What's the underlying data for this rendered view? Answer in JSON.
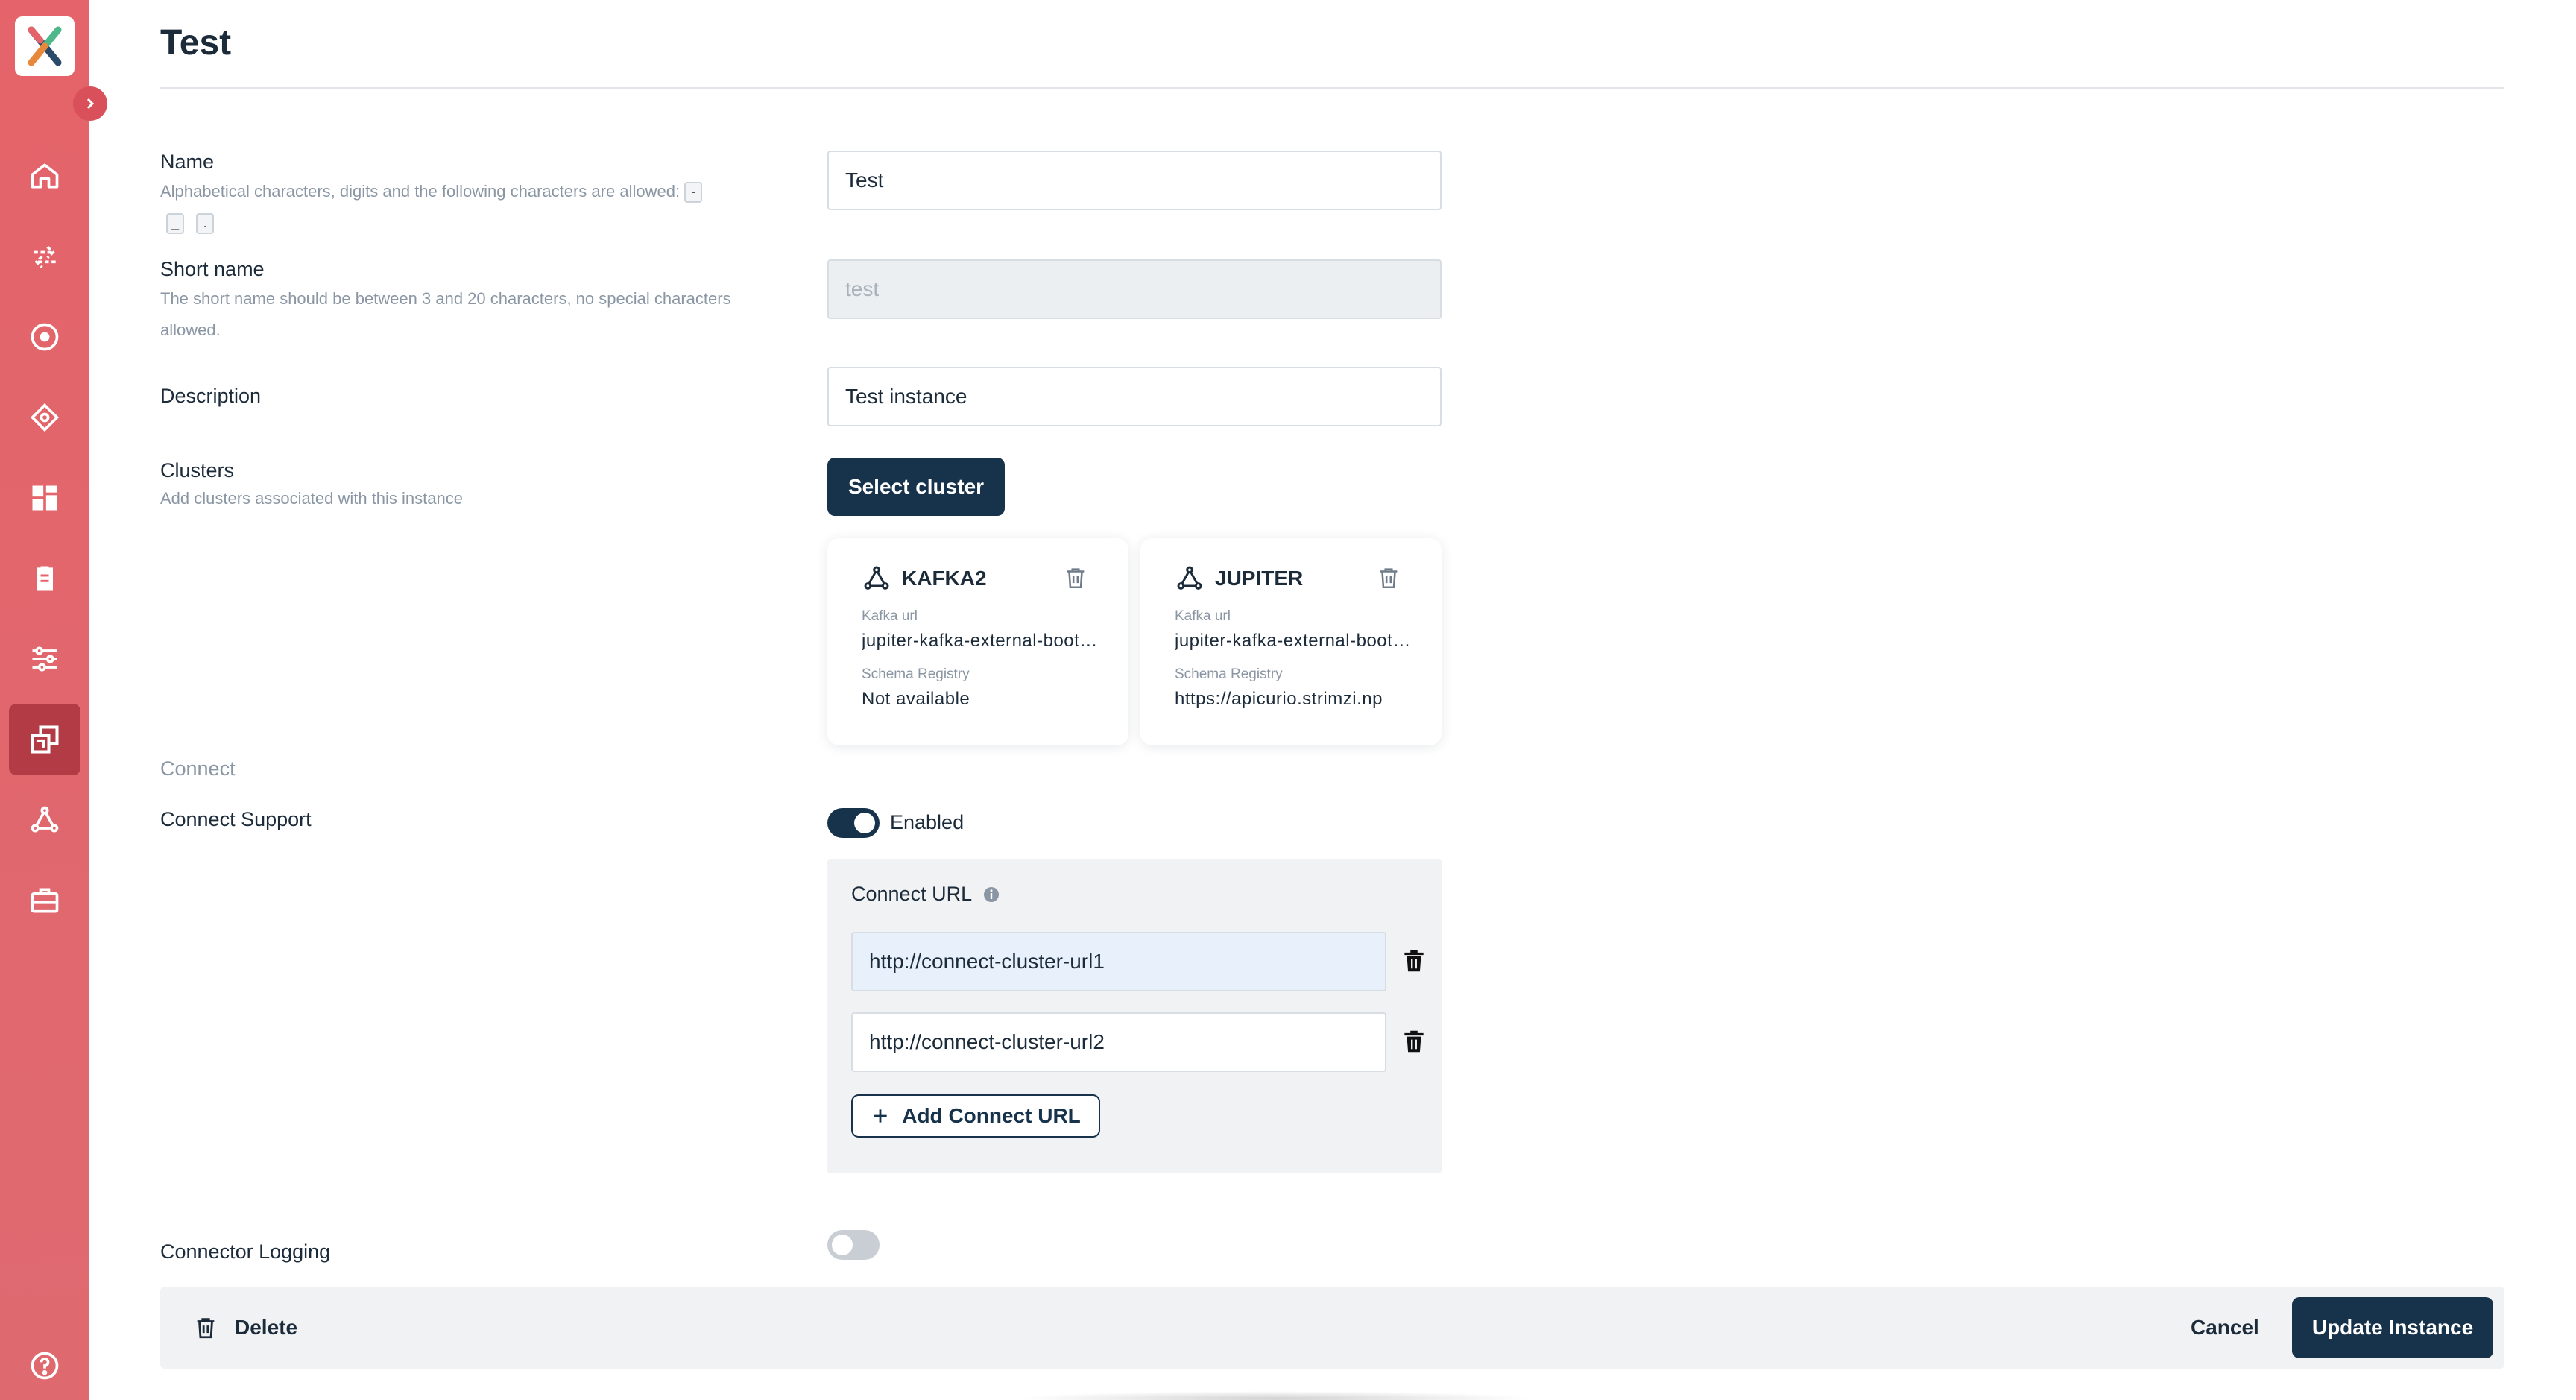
{
  "header": {
    "title": "Test"
  },
  "form": {
    "name": {
      "label": "Name",
      "hint": "Alphabetical characters, digits and the following characters are allowed:",
      "allowed_chars": [
        "-",
        "_",
        "."
      ],
      "value": "Test"
    },
    "short_name": {
      "label": "Short name",
      "hint_line1": "The short name should be between 3 and 20 characters, no special characters",
      "hint_line2": "allowed.",
      "placeholder": "test"
    },
    "description": {
      "label": "Description",
      "value": "Test instance"
    },
    "clusters": {
      "label": "Clusters",
      "hint": "Add clusters associated with this instance",
      "select_button": "Select cluster",
      "items": [
        {
          "name": "KAFKA2",
          "kafka_url_label": "Kafka url",
          "kafka_url": "jupiter-kafka-external-bootstrap",
          "schema_label": "Schema Registry",
          "schema_value": "Not available"
        },
        {
          "name": "JUPITER",
          "kafka_url_label": "Kafka url",
          "kafka_url": "jupiter-kafka-external-bootstrap",
          "schema_label": "Schema Registry",
          "schema_value": "https://apicurio.strimzi.np"
        }
      ]
    },
    "connect": {
      "section_label": "Connect",
      "support_label": "Connect Support",
      "support_enabled": true,
      "support_state_label": "Enabled",
      "url_label": "Connect URL",
      "urls": [
        "http://connect-cluster-url1",
        "http://connect-cluster-url2"
      ],
      "add_button": "Add Connect URL"
    },
    "connector_logging": {
      "label": "Connector Logging",
      "enabled": false
    }
  },
  "footer": {
    "delete_label": "Delete",
    "cancel_label": "Cancel",
    "update_label": "Update Instance"
  },
  "colors": {
    "sidebar": "#e5636a",
    "primary": "#17324b",
    "active_nav": "#b33b46"
  }
}
